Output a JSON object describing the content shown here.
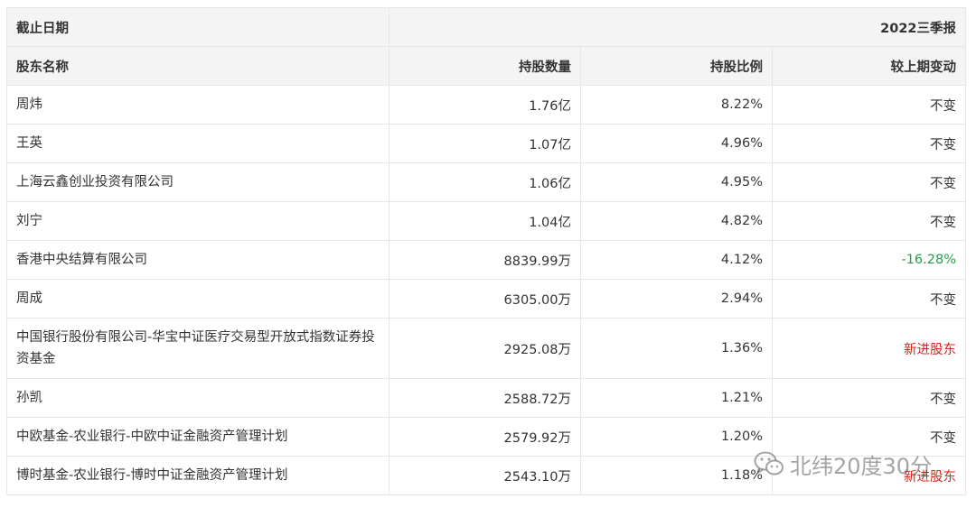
{
  "header": {
    "date_label": "截止日期",
    "period": "2022三季报",
    "col_name": "股东名称",
    "col_shares": "持股数量",
    "col_ratio": "持股比例",
    "col_change": "较上期变动"
  },
  "rows": [
    {
      "name": "周炜",
      "shares": "1.76亿",
      "ratio": "8.22%",
      "change": "不变"
    },
    {
      "name": "王英",
      "shares": "1.07亿",
      "ratio": "4.96%",
      "change": "不变"
    },
    {
      "name": "上海云鑫创业投资有限公司",
      "shares": "1.06亿",
      "ratio": "4.95%",
      "change": "不变"
    },
    {
      "name": "刘宁",
      "shares": "1.04亿",
      "ratio": "4.82%",
      "change": "不变"
    },
    {
      "name": "香港中央结算有限公司",
      "shares": "8839.99万",
      "ratio": "4.12%",
      "change": "-16.28%"
    },
    {
      "name": "周成",
      "shares": "6305.00万",
      "ratio": "2.94%",
      "change": "不变"
    },
    {
      "name": "中国银行股份有限公司-华宝中证医疗交易型开放式指数证券投资基金",
      "shares": "2925.08万",
      "ratio": "1.36%",
      "change": "新进股东"
    },
    {
      "name": "孙凯",
      "shares": "2588.72万",
      "ratio": "1.21%",
      "change": "不变"
    },
    {
      "name": "中欧基金-农业银行-中欧中证金融资产管理计划",
      "shares": "2579.92万",
      "ratio": "1.20%",
      "change": "不变"
    },
    {
      "name": "博时基金-农业银行-博时中证金融资产管理计划",
      "shares": "2543.10万",
      "ratio": "1.18%",
      "change": "新进股东"
    }
  ],
  "colors": {
    "negative": "#21a049",
    "new_holder": "#d9261c",
    "header_bg": "#f4f4f4",
    "border": "#e6e6e6"
  },
  "watermark": {
    "icon": "wechat-icon",
    "text": "北纬20度30分"
  }
}
